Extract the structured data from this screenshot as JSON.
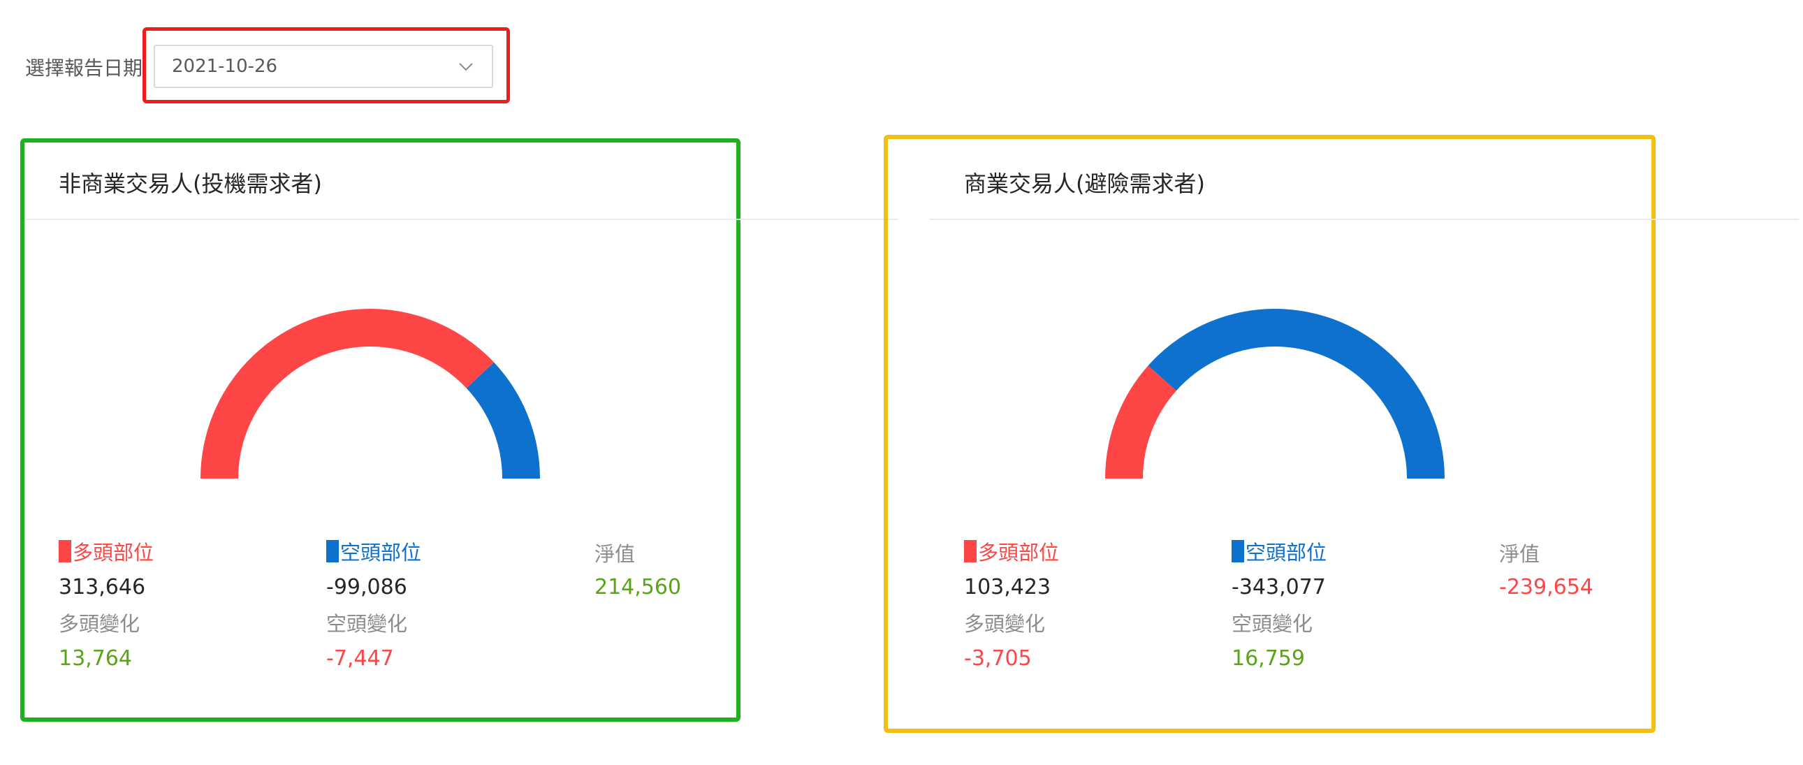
{
  "date_picker": {
    "label": "選擇報告日期",
    "value": "2021-10-26"
  },
  "colors": {
    "long": "#ff4646",
    "short": "#0e71ce",
    "positive": "#5ba319",
    "negative": "#ff4646",
    "annotation_red": "#ee1c1c",
    "annotation_green": "#1fb01f",
    "annotation_yellow": "#f7be12"
  },
  "panels": {
    "left": {
      "title": "非商業交易人(投機需求者)",
      "long_label": "多頭部位",
      "long_value": "313,646",
      "long_change_label": "多頭變化",
      "long_change": "13,764",
      "short_label": "空頭部位",
      "short_value": "-99,086",
      "short_change_label": "空頭變化",
      "short_change": "-7,447",
      "net_label": "淨值",
      "net_value": "214,560"
    },
    "right": {
      "title": "商業交易人(避險需求者)",
      "long_label": "多頭部位",
      "long_value": "103,423",
      "long_change_label": "多頭變化",
      "long_change": "-3,705",
      "short_label": "空頭部位",
      "short_value": "-343,077",
      "short_change_label": "空頭變化",
      "short_change": "16,759",
      "net_label": "淨值",
      "net_value": "-239,654"
    }
  },
  "chart_data": [
    {
      "type": "pie",
      "categories": [
        "多頭部位",
        "空頭部位"
      ],
      "values": [
        313646,
        99086
      ]
    },
    {
      "type": "pie",
      "categories": [
        "多頭部位",
        "空頭部位"
      ],
      "values": [
        103423,
        343077
      ]
    }
  ]
}
